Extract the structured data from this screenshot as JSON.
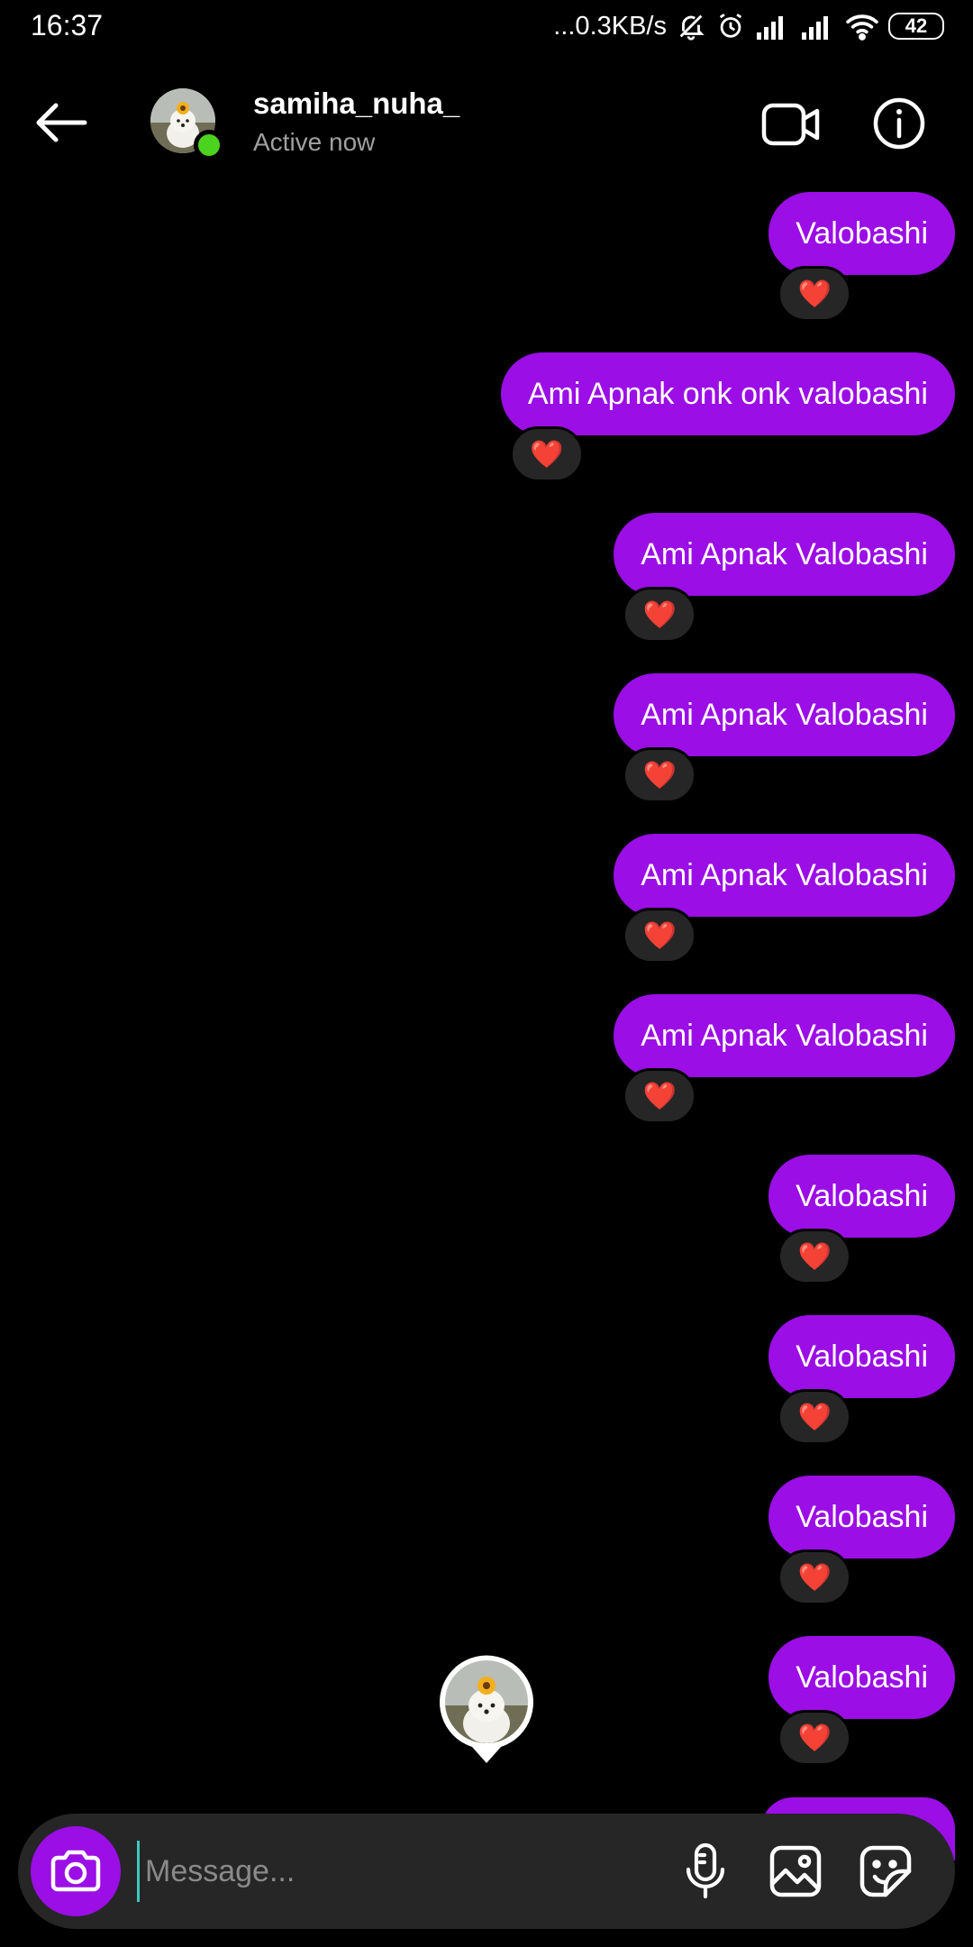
{
  "status_bar": {
    "time": "16:37",
    "network_speed": "...0.3KB/s",
    "battery": "42"
  },
  "header": {
    "username": "samiha_nuha_",
    "status": "Active now",
    "back_icon": "arrow-left-icon",
    "video_icon": "video-camera-icon",
    "info_icon": "info-icon"
  },
  "messages": [
    {
      "text": "Valobashi",
      "reaction": "❤️"
    },
    {
      "text": "Ami Apnak onk onk valobashi",
      "reaction": "❤️"
    },
    {
      "text": "Ami Apnak Valobashi",
      "reaction": "❤️"
    },
    {
      "text": "Ami Apnak Valobashi",
      "reaction": "❤️"
    },
    {
      "text": "Ami Apnak Valobashi",
      "reaction": "❤️"
    },
    {
      "text": "Ami Apnak Valobashi",
      "reaction": "❤️"
    },
    {
      "text": "Valobashi",
      "reaction": "❤️"
    },
    {
      "text": "Valobashi",
      "reaction": "❤️"
    },
    {
      "text": "Valobashi",
      "reaction": "❤️"
    },
    {
      "text": "Valobashi",
      "reaction": "❤️"
    }
  ],
  "composer": {
    "placeholder": "Message...",
    "value": ""
  },
  "colors": {
    "bubble": "#9b0ee6",
    "background": "#000000",
    "reaction_bg": "#262626",
    "online": "#4cd31e"
  }
}
